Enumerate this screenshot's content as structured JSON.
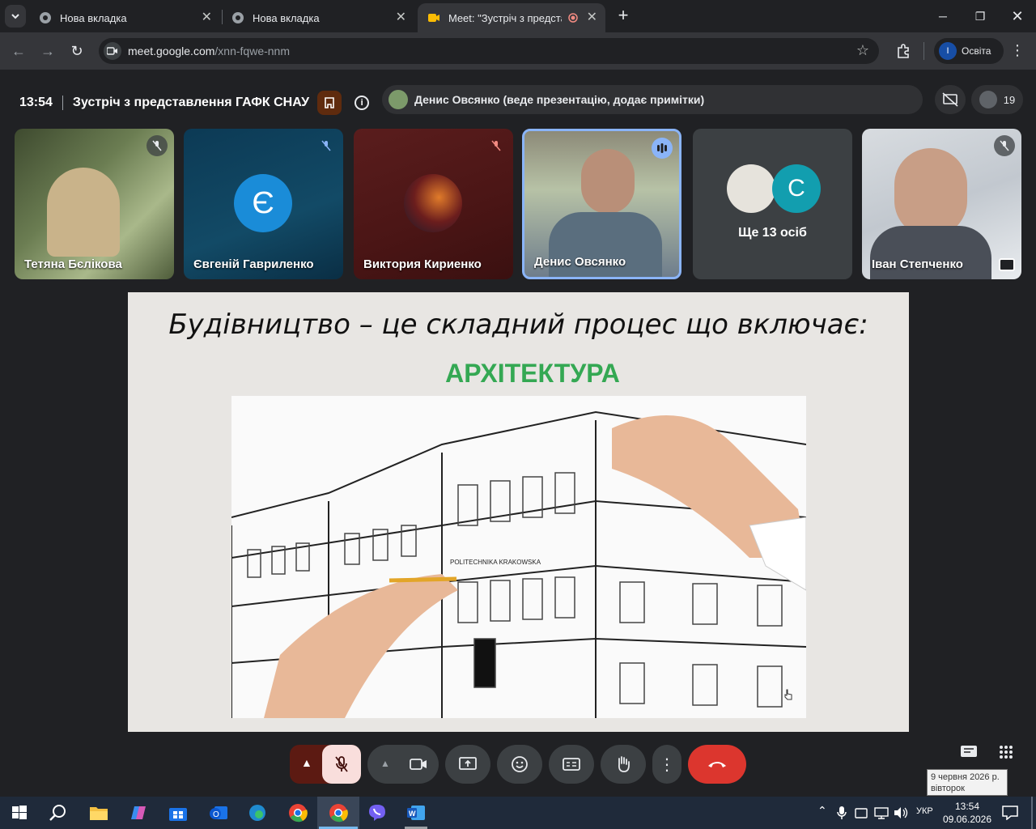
{
  "browser": {
    "tabs": [
      {
        "title": "Нова вкладка",
        "active": false
      },
      {
        "title": "Нова вкладка",
        "active": false
      },
      {
        "title": "Meet: \"Зустріч з представл",
        "active": true
      }
    ],
    "url_host": "meet.google.com",
    "url_path": "/xnn-fqwe-nnm",
    "profile_initial": "І",
    "profile_name": "Освіта"
  },
  "meet": {
    "time": "13:54",
    "meeting_title": "Зустріч з представлення ГАФК СНАУ",
    "presenter_status": "Денис Овсянко (веде презентацію, додає примітки)",
    "participant_count": "19",
    "accent_color": "#8ab4f8",
    "participants": [
      {
        "name": "Тетяна Бєлікова",
        "avatar": "",
        "muted": true
      },
      {
        "name": "Євгеній Гавриленко",
        "avatar": "Є",
        "muted": true
      },
      {
        "name": "Виктория Кириенко",
        "avatar": "",
        "muted": true
      },
      {
        "name": "Денис Овсянко",
        "avatar": "",
        "muted": false
      },
      {
        "name": "Ще 13 осіб",
        "avatar": "С",
        "muted": false
      },
      {
        "name": "Іван Степченко",
        "avatar": "",
        "muted": true
      }
    ],
    "slide": {
      "heading": "Будівництво – це складний процес що включає:",
      "subheading": "АРХІТЕКТУРА",
      "sign_text": "POLITECHNIKA KRAKOWSKA"
    }
  },
  "taskbar": {
    "language": "УКР",
    "clock_time": "13:54",
    "clock_date": "09.06.2026",
    "tooltip_line1": "9 червня 2026 р.",
    "tooltip_line2": "вівторок"
  }
}
